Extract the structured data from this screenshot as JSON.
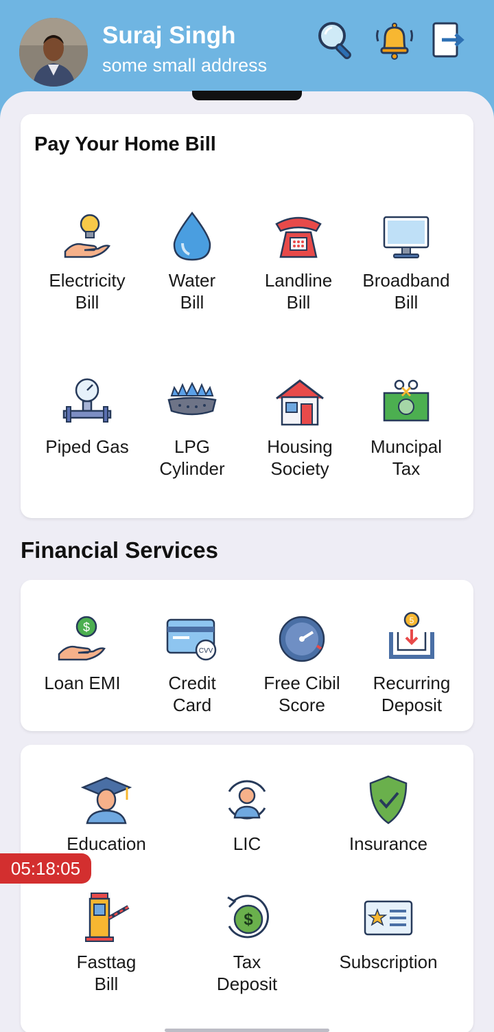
{
  "header": {
    "name": "Suraj Singh",
    "address": "some small address"
  },
  "home_bill": {
    "title": "Pay Your Home Bill",
    "items": [
      {
        "label": "Electricity\nBill",
        "icon": "electricity-icon"
      },
      {
        "label": "Water\nBill",
        "icon": "water-drop-icon"
      },
      {
        "label": "Landline\nBill",
        "icon": "telephone-icon"
      },
      {
        "label": "Broadband\nBill",
        "icon": "monitor-icon"
      },
      {
        "label": "Piped Gas",
        "icon": "gas-meter-icon"
      },
      {
        "label": "LPG\nCylinder",
        "icon": "gas-burner-icon"
      },
      {
        "label": "Housing\nSociety",
        "icon": "house-icon"
      },
      {
        "label": "Muncipal\nTax",
        "icon": "money-icon"
      }
    ]
  },
  "financial": {
    "title": "Financial Services",
    "items": [
      {
        "label": "Loan EMI",
        "icon": "loan-hand-icon"
      },
      {
        "label": "Credit\nCard",
        "icon": "credit-card-icon"
      },
      {
        "label": "Free Cibil\nScore",
        "icon": "speedometer-icon"
      },
      {
        "label": "Recurring\nDeposit",
        "icon": "deposit-icon"
      }
    ]
  },
  "other": {
    "items": [
      {
        "label": "Education",
        "icon": "graduation-icon"
      },
      {
        "label": "LIC",
        "icon": "person-cycle-icon"
      },
      {
        "label": "Insurance",
        "icon": "shield-check-icon"
      },
      {
        "label": "Fasttag\nBill",
        "icon": "toll-booth-icon"
      },
      {
        "label": "Tax\nDeposit",
        "icon": "dollar-cycle-icon"
      },
      {
        "label": "Subscription",
        "icon": "subscription-card-icon"
      }
    ]
  },
  "timer": "05:18:05",
  "colors": {
    "header_bg": "#6fb5e2",
    "page_bg": "#eeedf5",
    "timer_bg": "#d32f2f"
  }
}
